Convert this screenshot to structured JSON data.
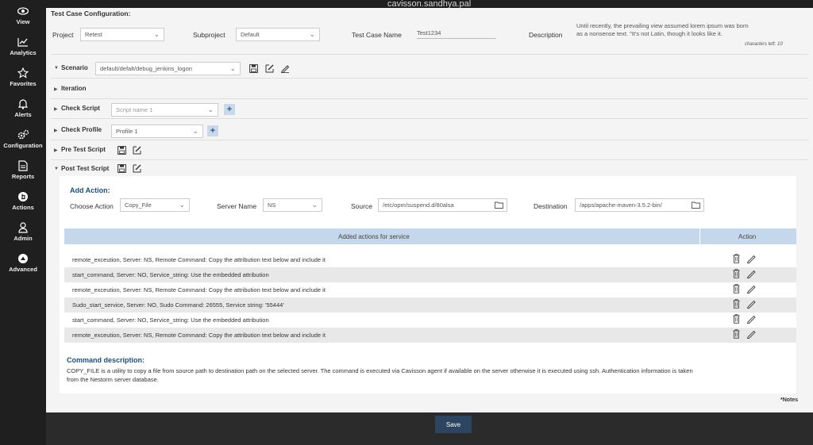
{
  "user": "cavisson.sandhya.pal",
  "sidebar": {
    "items": [
      {
        "label": "View",
        "icon": "eye-icon"
      },
      {
        "label": "Analytics",
        "icon": "chart-icon"
      },
      {
        "label": "Favorites",
        "icon": "star-icon"
      },
      {
        "label": "Alerts",
        "icon": "bell-icon"
      },
      {
        "label": "Configuration",
        "icon": "gears-icon"
      },
      {
        "label": "Reports",
        "icon": "document-icon"
      },
      {
        "label": "Actions",
        "icon": "pointer-icon"
      },
      {
        "label": "Admin",
        "icon": "user-icon"
      },
      {
        "label": "Advanced",
        "icon": "advanced-icon"
      }
    ]
  },
  "config": {
    "title": "Test Case Configuration:",
    "project_label": "Project",
    "project_value": "Retest",
    "subproject_label": "Subproject",
    "subproject_value": "Default",
    "testcase_label": "Test Case Name",
    "testcase_value": "Test1234",
    "description_label": "Description",
    "description_line1": "Until recently, the prevailing view assumed lorem ipsum was born",
    "description_line2": "as a nonsense text. \"It's not Latin, though it looks like it.",
    "chars_left": "characters left: 10"
  },
  "sections": {
    "scenario_label": "Scenario",
    "scenario_value": "default/defalt/debug_jenkins_logon",
    "iteration_label": "Iteration",
    "check_script_label": "Check Script",
    "check_script_placeholder": "Script name 1",
    "check_profile_label": "Check Profile",
    "check_profile_value": "Profile 1",
    "pre_test_label": "Pre Test Script",
    "post_test_label": "Post Test Script"
  },
  "add_action": {
    "title": "Add Action:",
    "choose_label": "Choose Action",
    "choose_value": "Copy_File",
    "server_label": "Server Name",
    "server_value": "NS",
    "source_label": "Source",
    "source_value": "/etc/opm/suspend.d/80alsa",
    "dest_label": "Destination",
    "dest_value": "/apps/apache-maven-3.5.2-bin/"
  },
  "table": {
    "col_actions": "Added actions for service",
    "col_action": "Action",
    "rows": [
      "remote_exceution, Server: NS, Remote Command: Copy the attribution text below and include it",
      "start_command, Server: NO, Service_string: Use the embedded attribution",
      "remote_exceution, Server: NS, Remote Command: Copy the attribution text below and include it",
      "Sudo_start_service, Server: NO, Sudo Command: 26555, Service string: '55444'",
      "start_command, Server: NO, Service_string: Use the embedded attribution",
      "remote_exceution, Server: NS, Remote Command: Copy the attribution text below and include it"
    ]
  },
  "command": {
    "title": "Command description:",
    "line1": "COPY_FILE is a utility to copy a file from source path to destination path on the selected server. The command is executed via Cavisson agent if available on the server otherwise it is executed using ssh. Authentication information is taken",
    "line2": "from the Nestorm server database."
  },
  "notes": "*Notes",
  "save": "Save"
}
